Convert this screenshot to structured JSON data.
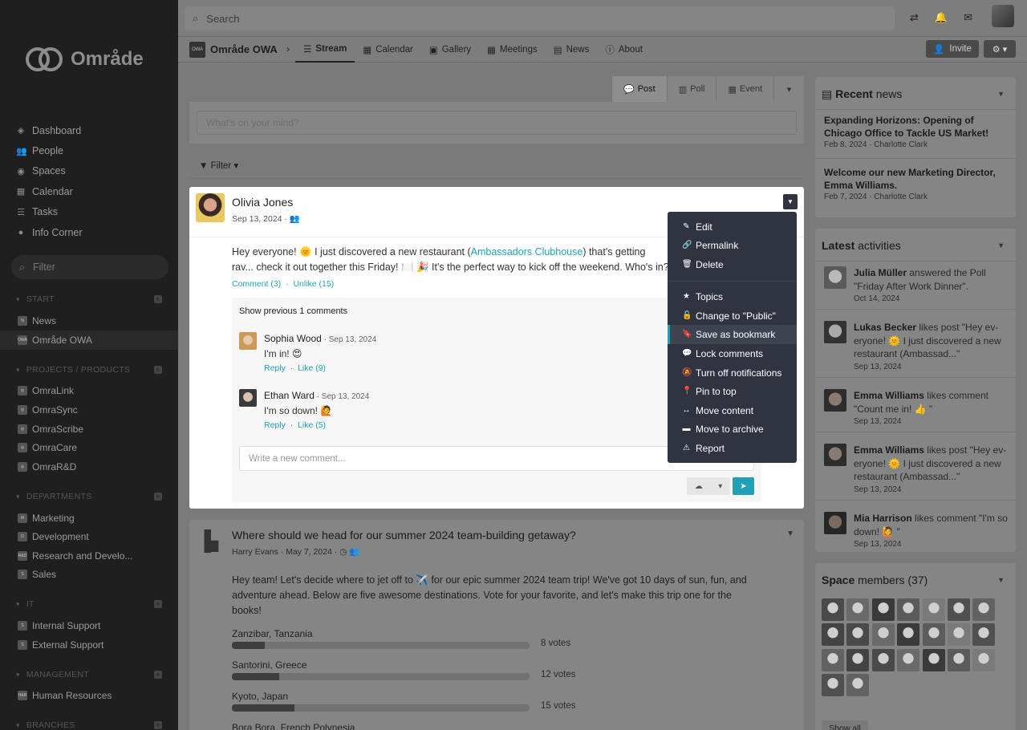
{
  "sidebar": {
    "brand": "Område",
    "nav": [
      {
        "label": "Dashboard",
        "icon": "dashboard-icon",
        "glyph": "◈"
      },
      {
        "label": "People",
        "icon": "people-icon",
        "glyph": "👥"
      },
      {
        "label": "Spaces",
        "icon": "spaces-icon",
        "glyph": "◉"
      },
      {
        "label": "Calendar",
        "icon": "calendar-icon",
        "glyph": "▦"
      },
      {
        "label": "Tasks",
        "icon": "tasks-icon",
        "glyph": "☰"
      },
      {
        "label": "Info Corner",
        "icon": "info-icon",
        "glyph": "●"
      }
    ],
    "filter_placeholder": "Filter",
    "sections": {
      "start": "START",
      "projects": "PROJECTS / PRODUCTS",
      "departments": "DEPARTMENTS",
      "it": "IT",
      "management": "MANAGEMENT",
      "branches": "BRANCHES"
    },
    "spaces": {
      "news": {
        "label": "News",
        "badge": "N"
      },
      "omrade": {
        "label": "Område OWA",
        "badge": "OWA"
      },
      "omralink": {
        "label": "OmraLink",
        "badge": "◎"
      },
      "omrasync": {
        "label": "OmraSync",
        "badge": "◎"
      },
      "omrascribe": {
        "label": "OmraScribe",
        "badge": "◎"
      },
      "omracare": {
        "label": "OmraCare",
        "badge": "◎"
      },
      "omrard": {
        "label": "OmraR&D",
        "badge": "◎"
      },
      "marketing": {
        "label": "Marketing",
        "badge": "M"
      },
      "development": {
        "label": "Development",
        "badge": "D"
      },
      "research": {
        "label": "Research and Develo...",
        "badge": "R&D"
      },
      "sales": {
        "label": "Sales",
        "badge": "S"
      },
      "internal": {
        "label": "Internal Support",
        "badge": "S"
      },
      "external": {
        "label": "External Support",
        "badge": "S"
      },
      "hr": {
        "label": "Human Resources",
        "badge": "H&R"
      }
    }
  },
  "topbar": {
    "search_placeholder": "Search"
  },
  "space": {
    "badge": "OWA",
    "name": "Område OWA",
    "tabs": [
      {
        "label": "Stream",
        "icon": "stream-icon",
        "glyph": "☰"
      },
      {
        "label": "Calendar",
        "icon": "calendar-icon",
        "glyph": "▦"
      },
      {
        "label": "Gallery",
        "icon": "gallery-icon",
        "glyph": "▣"
      },
      {
        "label": "Meetings",
        "icon": "meetings-icon",
        "glyph": "▦"
      },
      {
        "label": "News",
        "icon": "news-icon",
        "glyph": "▤"
      },
      {
        "label": "About",
        "icon": "about-icon",
        "glyph": "ⓘ"
      }
    ],
    "invite_label": "Invite"
  },
  "composer": {
    "tabs": [
      "Post",
      "Poll",
      "Event"
    ],
    "placeholder": "What's on your mind?",
    "filter_label": "Filter"
  },
  "post": {
    "author": "Olivia Jones",
    "date": "Sep 13, 2024 ·",
    "text_before": "Hey everyone! 🌞 I just discovered a new restaurant (",
    "link": "Ambassadors Clubhouse",
    "text_after": ") that's getting rav... check it out together this Friday! 🍽️ 🎉 It's the perfect way to kick off the weekend. Who's in?",
    "comment_link": "Comment (3)",
    "like_link": "Unlike (15)",
    "show_previous": "Show previous 1 comments",
    "comments": [
      {
        "author": "Sophia Wood",
        "date": " · Sep 13, 2024",
        "text": "I'm in! 😍",
        "reply": "Reply",
        "like": "Like (9)"
      },
      {
        "author": "Ethan Ward",
        "date": " · Sep 13, 2024",
        "text": "I'm so down! 🙋",
        "reply": "Reply",
        "like": "Like (5)"
      }
    ],
    "comment_placeholder": "Write a new comment..."
  },
  "menu": [
    {
      "label": "Edit",
      "icon": "edit-icon",
      "glyph": "✎"
    },
    {
      "label": "Permalink",
      "icon": "link-icon",
      "glyph": "🔗"
    },
    {
      "label": "Delete",
      "icon": "trash-icon",
      "glyph": "🗑"
    },
    {
      "label": "Topics",
      "icon": "star-icon",
      "glyph": "★"
    },
    {
      "label": "Change to \"Public\"",
      "icon": "unlock-icon",
      "glyph": "🔓"
    },
    {
      "label": "Save as bookmark",
      "icon": "bookmark-icon",
      "glyph": "🔖"
    },
    {
      "label": "Lock comments",
      "icon": "comment-icon",
      "glyph": "💬"
    },
    {
      "label": "Turn off notifications",
      "icon": "bell-off-icon",
      "glyph": "🔕"
    },
    {
      "label": "Pin to top",
      "icon": "pin-icon",
      "glyph": "📍"
    },
    {
      "label": "Move content",
      "icon": "move-icon",
      "glyph": "↔"
    },
    {
      "label": "Move to archive",
      "icon": "archive-icon",
      "glyph": "▬"
    },
    {
      "label": "Report",
      "icon": "report-icon",
      "glyph": "⚠"
    }
  ],
  "poll": {
    "title": "Where should we head for our summer 2024 team-building getaway?",
    "meta": "Harry Evans · May 7, 2024 ·",
    "description": "Hey team! Let's decide where to jet off to ✈️ for our epic summer 2024 team trip! We've got 10 days of sun, fun, and adventure ahead. Below are five awesome destinations. Vote for your favorite, and let's make this trip one for the books!",
    "options": [
      {
        "label": "Zanzibar, Tanzania",
        "votes_label": "8 votes",
        "share": 0.11
      },
      {
        "label": "Santorini, Greece",
        "votes_label": "12 votes",
        "share": 0.16
      },
      {
        "label": "Kyoto, Japan",
        "votes_label": "15 votes",
        "share": 0.21
      },
      {
        "label": "Bora Bora, French Polynesia",
        "votes_label": "",
        "share": 0.0
      }
    ]
  },
  "recent_news": {
    "title_strong": "Recent",
    "title_rest": " news",
    "items": [
      {
        "title": "Expanding Horizons: Opening of Chicago Office to Tackle US Market!",
        "meta": "Feb 8, 2024 · Charlotte Clark"
      },
      {
        "title": "Welcome our new Marketing Director, Emma Williams.",
        "meta": "Feb 7, 2024 · Charlotte Clark"
      }
    ]
  },
  "activities": {
    "title_strong": "Latest",
    "title_rest": " activities",
    "items": [
      {
        "who": "Julia Müller",
        "what": " answered the Poll \"Friday After Work Dinner\".",
        "date": "Oct 14, 2024"
      },
      {
        "who": "Lukas Becker",
        "what": " likes post \"Hey ev- eryone! 🌞 I just discovered a new restaurant (Ambassad...\"",
        "date": "Sep 13, 2024"
      },
      {
        "who": "Emma Williams",
        "what": " likes comment \"Count me in! 👍 \"",
        "date": "Sep 13, 2024"
      },
      {
        "who": "Emma Williams",
        "what": " likes post \"Hey ev- eryone! 🌞 I just discovered a new restaurant (Ambassad...\"",
        "date": "Sep 13, 2024"
      },
      {
        "who": "Mia Harrison",
        "what": " likes comment \"I'm so down! 🙋 \"",
        "date": "Sep 13, 2024"
      }
    ]
  },
  "members": {
    "title_strong": "Space",
    "title_rest": " members (37)",
    "count": 23,
    "show_all": "Show all"
  }
}
